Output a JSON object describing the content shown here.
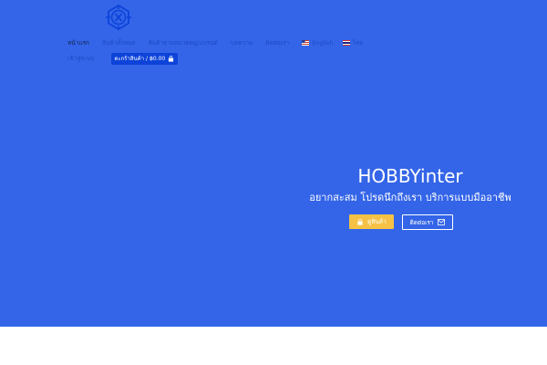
{
  "brand": {
    "logo_icon": "hexagon-compass-logo",
    "logo_color": "#0d43d9"
  },
  "nav": {
    "items": [
      {
        "label": "หน้าแรก",
        "active": true
      },
      {
        "label": "สินค้าทั้งหมด"
      },
      {
        "label": "สินค้าตามหมวดหมู่/แบรนด์"
      },
      {
        "label": "บทความ"
      },
      {
        "label": "ติดต่อเรา"
      }
    ],
    "languages": [
      {
        "label": "English",
        "flag_icon": "us-flag-icon"
      },
      {
        "label": "ไทย",
        "flag_icon": "thai-flag-icon"
      }
    ],
    "account_label": "เข้าสู่ระบบ",
    "cart": {
      "label": "ตะกร้าสินค้า",
      "separator": "/",
      "amount": "฿0.00",
      "icon": "shopping-bag-icon"
    }
  },
  "hero": {
    "title": "HOBBYinter",
    "subtitle": "อยากสะสม โปรดนึกถึงเรา บริการแบบมืออาชีพ",
    "shop_button": {
      "label": "ดูสินค้า",
      "icon": "shopping-bag-icon"
    },
    "contact_button": {
      "label": "ติดต่อเรา",
      "icon": "envelope-icon"
    }
  },
  "colors": {
    "hero_background": "#3465e8",
    "nav_text": "#1d49c4",
    "cart_button": "#0d43d9",
    "shop_button": "#f5c246"
  }
}
